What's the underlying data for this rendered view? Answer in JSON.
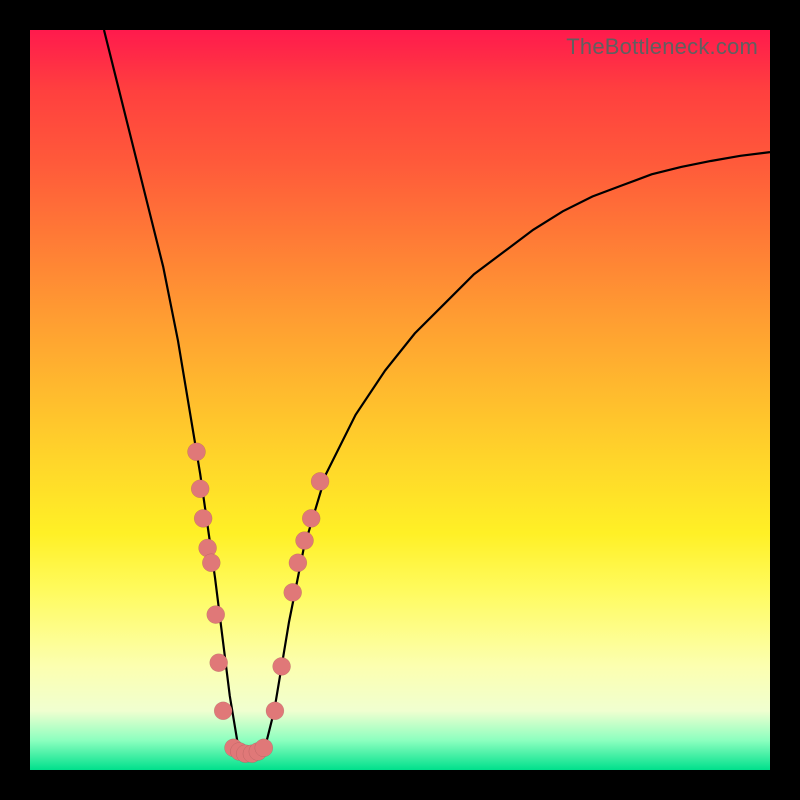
{
  "watermark": "TheBottleneck.com",
  "colors": {
    "marker": "#e07878",
    "curve": "#000000"
  },
  "chart_data": {
    "type": "line",
    "title": "",
    "xlabel": "",
    "ylabel": "",
    "xlim": [
      0,
      100
    ],
    "ylim": [
      0,
      100
    ],
    "grid": false,
    "series": [
      {
        "name": "bottleneck-curve",
        "x": [
          10,
          12,
          14,
          16,
          18,
          20,
          21,
          22,
          23,
          24,
          25,
          26,
          27,
          28,
          29,
          30,
          31,
          32,
          33,
          34,
          35,
          37,
          40,
          44,
          48,
          52,
          56,
          60,
          64,
          68,
          72,
          76,
          80,
          84,
          88,
          92,
          96,
          100
        ],
        "y": [
          100,
          92,
          84,
          76,
          68,
          58,
          52,
          46,
          40,
          33,
          26,
          18,
          10,
          4,
          2,
          2,
          2,
          4,
          8,
          14,
          20,
          30,
          40,
          48,
          54,
          59,
          63,
          67,
          70,
          73,
          75.5,
          77.5,
          79,
          80.5,
          81.5,
          82.3,
          83,
          83.5
        ]
      }
    ],
    "markers": {
      "name": "highlighted-points",
      "points": [
        {
          "x": 22.5,
          "y": 43
        },
        {
          "x": 23.0,
          "y": 38
        },
        {
          "x": 23.4,
          "y": 34
        },
        {
          "x": 24.0,
          "y": 30
        },
        {
          "x": 24.5,
          "y": 28
        },
        {
          "x": 25.1,
          "y": 21
        },
        {
          "x": 25.5,
          "y": 14.5
        },
        {
          "x": 26.1,
          "y": 8
        },
        {
          "x": 27.5,
          "y": 3
        },
        {
          "x": 28.3,
          "y": 2.5
        },
        {
          "x": 29.1,
          "y": 2.2
        },
        {
          "x": 30.0,
          "y": 2.2
        },
        {
          "x": 30.8,
          "y": 2.5
        },
        {
          "x": 31.6,
          "y": 3
        },
        {
          "x": 33.1,
          "y": 8
        },
        {
          "x": 34.0,
          "y": 14
        },
        {
          "x": 35.5,
          "y": 24
        },
        {
          "x": 36.2,
          "y": 28
        },
        {
          "x": 37.1,
          "y": 31
        },
        {
          "x": 38.0,
          "y": 34
        },
        {
          "x": 39.2,
          "y": 39
        }
      ]
    }
  }
}
